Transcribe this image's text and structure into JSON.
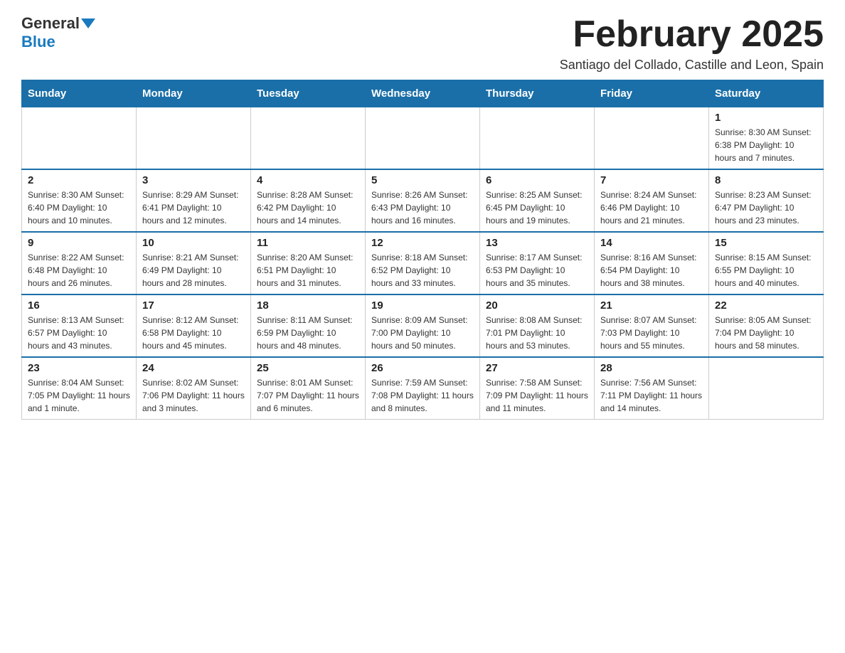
{
  "header": {
    "logo_general": "General",
    "logo_blue": "Blue",
    "month_title": "February 2025",
    "subtitle": "Santiago del Collado, Castille and Leon, Spain"
  },
  "calendar": {
    "days_of_week": [
      "Sunday",
      "Monday",
      "Tuesday",
      "Wednesday",
      "Thursday",
      "Friday",
      "Saturday"
    ],
    "weeks": [
      [
        {
          "day": "",
          "info": ""
        },
        {
          "day": "",
          "info": ""
        },
        {
          "day": "",
          "info": ""
        },
        {
          "day": "",
          "info": ""
        },
        {
          "day": "",
          "info": ""
        },
        {
          "day": "",
          "info": ""
        },
        {
          "day": "1",
          "info": "Sunrise: 8:30 AM\nSunset: 6:38 PM\nDaylight: 10 hours and 7 minutes."
        }
      ],
      [
        {
          "day": "2",
          "info": "Sunrise: 8:30 AM\nSunset: 6:40 PM\nDaylight: 10 hours and 10 minutes."
        },
        {
          "day": "3",
          "info": "Sunrise: 8:29 AM\nSunset: 6:41 PM\nDaylight: 10 hours and 12 minutes."
        },
        {
          "day": "4",
          "info": "Sunrise: 8:28 AM\nSunset: 6:42 PM\nDaylight: 10 hours and 14 minutes."
        },
        {
          "day": "5",
          "info": "Sunrise: 8:26 AM\nSunset: 6:43 PM\nDaylight: 10 hours and 16 minutes."
        },
        {
          "day": "6",
          "info": "Sunrise: 8:25 AM\nSunset: 6:45 PM\nDaylight: 10 hours and 19 minutes."
        },
        {
          "day": "7",
          "info": "Sunrise: 8:24 AM\nSunset: 6:46 PM\nDaylight: 10 hours and 21 minutes."
        },
        {
          "day": "8",
          "info": "Sunrise: 8:23 AM\nSunset: 6:47 PM\nDaylight: 10 hours and 23 minutes."
        }
      ],
      [
        {
          "day": "9",
          "info": "Sunrise: 8:22 AM\nSunset: 6:48 PM\nDaylight: 10 hours and 26 minutes."
        },
        {
          "day": "10",
          "info": "Sunrise: 8:21 AM\nSunset: 6:49 PM\nDaylight: 10 hours and 28 minutes."
        },
        {
          "day": "11",
          "info": "Sunrise: 8:20 AM\nSunset: 6:51 PM\nDaylight: 10 hours and 31 minutes."
        },
        {
          "day": "12",
          "info": "Sunrise: 8:18 AM\nSunset: 6:52 PM\nDaylight: 10 hours and 33 minutes."
        },
        {
          "day": "13",
          "info": "Sunrise: 8:17 AM\nSunset: 6:53 PM\nDaylight: 10 hours and 35 minutes."
        },
        {
          "day": "14",
          "info": "Sunrise: 8:16 AM\nSunset: 6:54 PM\nDaylight: 10 hours and 38 minutes."
        },
        {
          "day": "15",
          "info": "Sunrise: 8:15 AM\nSunset: 6:55 PM\nDaylight: 10 hours and 40 minutes."
        }
      ],
      [
        {
          "day": "16",
          "info": "Sunrise: 8:13 AM\nSunset: 6:57 PM\nDaylight: 10 hours and 43 minutes."
        },
        {
          "day": "17",
          "info": "Sunrise: 8:12 AM\nSunset: 6:58 PM\nDaylight: 10 hours and 45 minutes."
        },
        {
          "day": "18",
          "info": "Sunrise: 8:11 AM\nSunset: 6:59 PM\nDaylight: 10 hours and 48 minutes."
        },
        {
          "day": "19",
          "info": "Sunrise: 8:09 AM\nSunset: 7:00 PM\nDaylight: 10 hours and 50 minutes."
        },
        {
          "day": "20",
          "info": "Sunrise: 8:08 AM\nSunset: 7:01 PM\nDaylight: 10 hours and 53 minutes."
        },
        {
          "day": "21",
          "info": "Sunrise: 8:07 AM\nSunset: 7:03 PM\nDaylight: 10 hours and 55 minutes."
        },
        {
          "day": "22",
          "info": "Sunrise: 8:05 AM\nSunset: 7:04 PM\nDaylight: 10 hours and 58 minutes."
        }
      ],
      [
        {
          "day": "23",
          "info": "Sunrise: 8:04 AM\nSunset: 7:05 PM\nDaylight: 11 hours and 1 minute."
        },
        {
          "day": "24",
          "info": "Sunrise: 8:02 AM\nSunset: 7:06 PM\nDaylight: 11 hours and 3 minutes."
        },
        {
          "day": "25",
          "info": "Sunrise: 8:01 AM\nSunset: 7:07 PM\nDaylight: 11 hours and 6 minutes."
        },
        {
          "day": "26",
          "info": "Sunrise: 7:59 AM\nSunset: 7:08 PM\nDaylight: 11 hours and 8 minutes."
        },
        {
          "day": "27",
          "info": "Sunrise: 7:58 AM\nSunset: 7:09 PM\nDaylight: 11 hours and 11 minutes."
        },
        {
          "day": "28",
          "info": "Sunrise: 7:56 AM\nSunset: 7:11 PM\nDaylight: 11 hours and 14 minutes."
        },
        {
          "day": "",
          "info": ""
        }
      ]
    ]
  }
}
